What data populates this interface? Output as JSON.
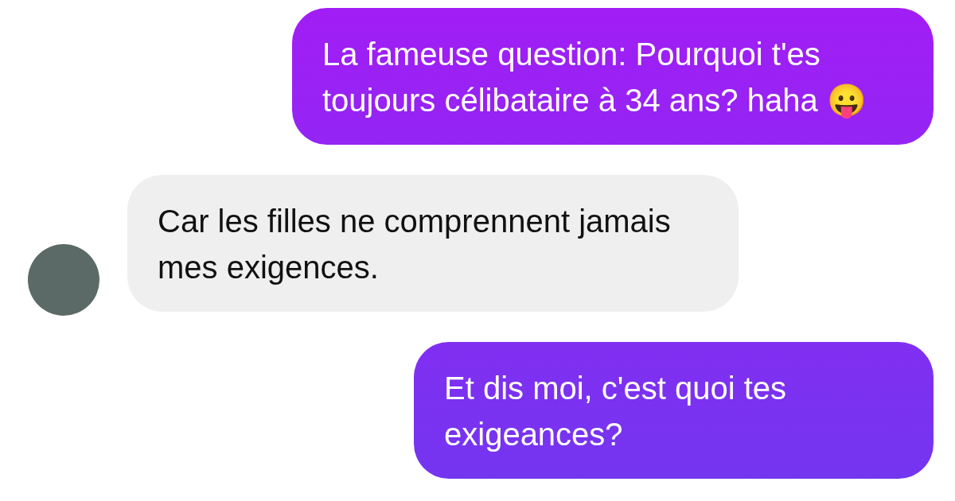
{
  "messages": [
    {
      "kind": "sent",
      "text": "La fameuse question: Pourquoi t'es toujours célibataire à 34 ans? haha 😛"
    },
    {
      "kind": "received",
      "text": "Car les filles ne comprennent jamais mes exigences.",
      "avatar": true
    },
    {
      "kind": "sent",
      "text": "Et dis moi, c'est quoi tes exigeances?"
    }
  ]
}
